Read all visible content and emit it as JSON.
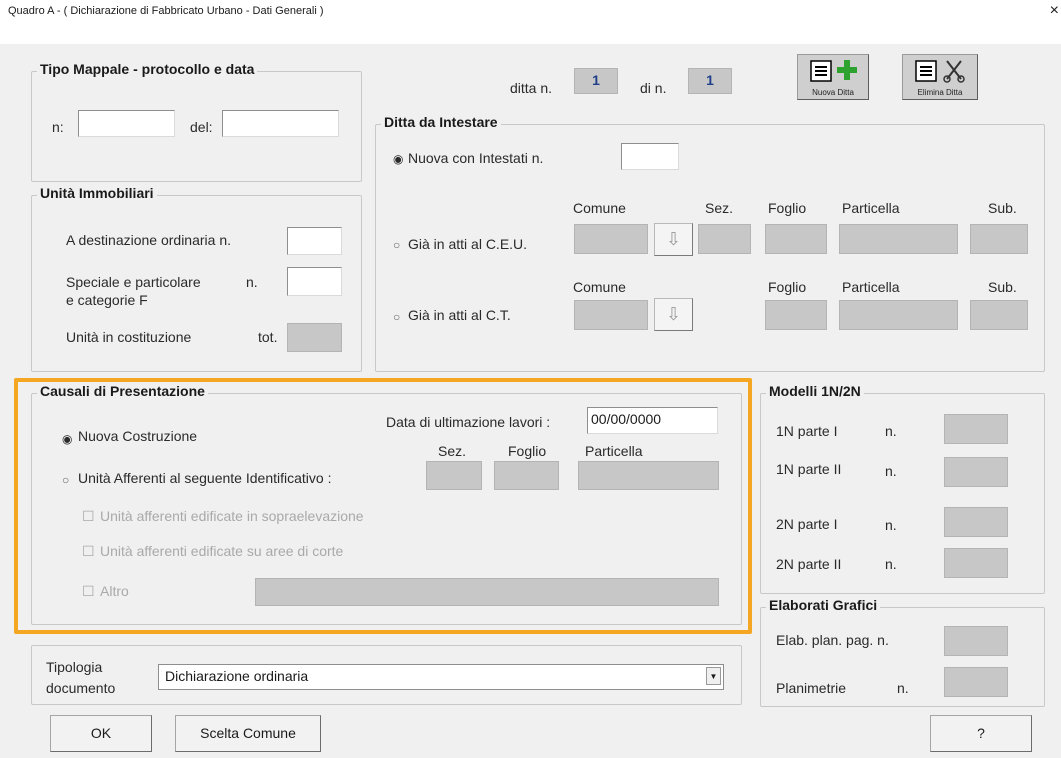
{
  "window": {
    "title": "Quadro A - ( Dichiarazione di Fabbricato Urbano - Dati Generali )",
    "close_glyph": "×"
  },
  "tipo_mappale": {
    "legend": "Tipo Mappale - protocollo e data",
    "n_label": "n:",
    "del_label": "del:",
    "n_value": "",
    "del_value": ""
  },
  "unita": {
    "legend": "Unità Immobiliari",
    "ordinaria_label": "A destinazione ordinaria  n.",
    "speciale_label_1": "Speciale e particolare",
    "speciale_n": "n.",
    "speciale_label_2": "e categorie F",
    "costituzione_label": "Unità in costituzione",
    "tot_label": "tot.",
    "ordinaria_value": "",
    "speciale_value": ""
  },
  "ditta": {
    "ditta_label": "ditta n.",
    "ditta_value": "1",
    "di_label": "di n.",
    "di_value": "1",
    "nuova_btn": "Nuova Ditta",
    "elimina_btn": "Elimina Ditta"
  },
  "intestare": {
    "legend": "Ditta da Intestare",
    "nuova_label": "Nuova con Intestati  n.",
    "nuova_value": "",
    "ceu_label": "Già in atti al C.E.U.",
    "ct_label": "Già in atti al C.T.",
    "headers_ceu": {
      "comune": "Comune",
      "sez": "Sez.",
      "foglio": "Foglio",
      "particella": "Particella",
      "sub": "Sub."
    },
    "headers_ct": {
      "comune": "Comune",
      "foglio": "Foglio",
      "particella": "Particella",
      "sub": "Sub."
    },
    "selected": "nuova"
  },
  "causali": {
    "legend": "Causali di Presentazione",
    "data_label": "Data di ultimazione lavori :",
    "data_value": "00/00/0000",
    "nuova_label": "Nuova Costruzione",
    "afferenti_label": "Unità Afferenti al seguente Identificativo  :",
    "sez_header": "Sez.",
    "foglio_header": "Foglio",
    "particella_header": "Particella",
    "check_sopra": "Unità afferenti edificate in sopraelevazione",
    "check_corte": "Unità afferenti edificate su aree di corte",
    "check_altro": "Altro",
    "selected": "nuova"
  },
  "modelli": {
    "legend": "Modelli 1N/2N",
    "rows": [
      {
        "label": "1N parte I",
        "n": "n."
      },
      {
        "label": "1N parte II",
        "n": "n."
      },
      {
        "label": "2N parte I",
        "n": "n."
      },
      {
        "label": "2N parte II",
        "n": "n."
      }
    ]
  },
  "elaborati": {
    "legend": "Elaborati Grafici",
    "elab_label": "Elab. plan. pag. n.",
    "planimetrie_label": "Planimetrie",
    "planimetrie_n": "n."
  },
  "tipologia": {
    "label_1": "Tipologia",
    "label_2": "documento",
    "value": "Dichiarazione ordinaria"
  },
  "buttons": {
    "ok": "OK",
    "scelta": "Scelta Comune",
    "help": "?"
  },
  "colors": {
    "highlight": "#f5a623",
    "number_blue": "#1f3f8a",
    "plus_green": "#2ea22e"
  },
  "icons": [
    "list-icon",
    "plus-icon",
    "scissors-icon",
    "arrow-down-icon",
    "dropdown-arrow-icon",
    "close-icon"
  ]
}
